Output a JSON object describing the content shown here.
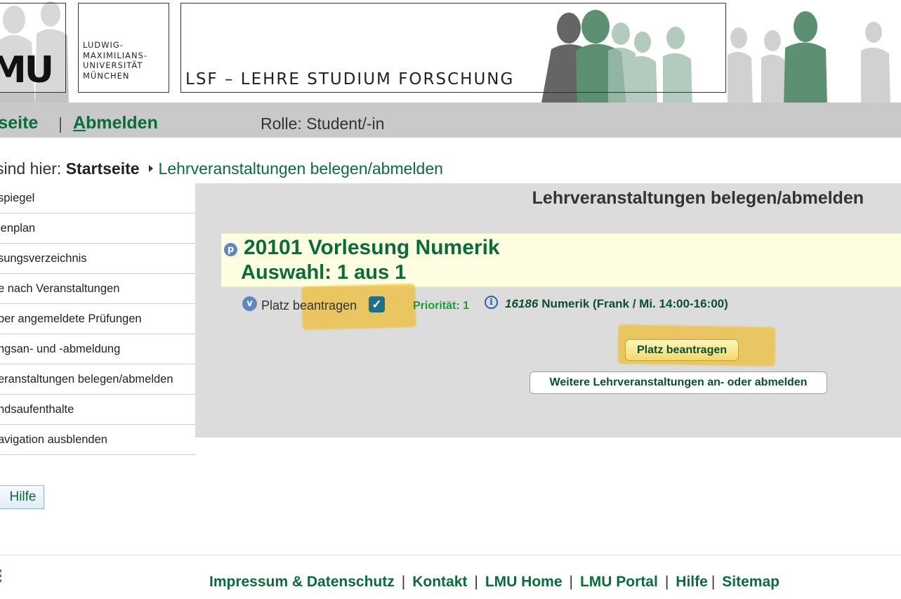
{
  "header": {
    "logo_letters": "MU",
    "university_name": "LUDWIG-\nMAXIMILIANS-\nUNIVERSITÄT\nMÜNCHEN",
    "site_title": "LSF – LEHRE STUDIUM FORSCHUNG"
  },
  "topnav": {
    "home_label": "tseite",
    "separator": "|",
    "logout_first": "A",
    "logout_rest": "bmelden",
    "role": "Rolle: Student/-in"
  },
  "breadcrumb": {
    "prefix": "sind hier:",
    "current": "Startseite",
    "link": "Lehrveranstaltungen belegen/abmelden"
  },
  "sidebar": {
    "items": [
      {
        "label": "spiegel"
      },
      {
        "label": "lenplan"
      },
      {
        "label": "sungsverzeichnis"
      },
      {
        "label": "e nach Veranstaltungen"
      },
      {
        "label": "ber angemeldete Prüfungen"
      },
      {
        "label": "ngsan- und -abmeldung"
      },
      {
        "label": "eranstaltungen belegen/abmelden"
      },
      {
        "label": "ndsaufenthalte"
      },
      {
        "label": "avigation ausblenden"
      }
    ],
    "help_label": "Hilfe"
  },
  "main": {
    "title": "Lehrveranstaltungen belegen/abmelden",
    "course": {
      "icon": "p",
      "title": "20101 Vorlesung Numerik",
      "choice": "Auswahl: 1 aus 1"
    },
    "option": {
      "icon": "v",
      "label": "Platz beantragen",
      "checked": true,
      "check_glyph": "✓",
      "priority": "Priorität: 1",
      "info_glyph": "i",
      "course_number": "16186",
      "course_text": "Numerik (Frank / Mi.  14:00-16:00)"
    },
    "apply_button": "Platz beantragen",
    "more_button": "Weitere Lehrveranstaltungen an- oder abmelden"
  },
  "footer": {
    "links": [
      "Impressum & Datenschutz",
      "Kontakt",
      "LMU Home",
      "LMU Portal",
      "Hilfe",
      "Sitemap"
    ],
    "separator": "|"
  },
  "colors": {
    "brand_green": "#0b6b3a",
    "nav_bar": "#c9c9c9",
    "panel": "#dcdcdc",
    "course_box": "#fdfde2",
    "highlight": "#eebe32",
    "icon_blue": "#5e87c2"
  },
  "icons": {
    "course_marker": "p-circle-icon",
    "option_marker": "v-circle-icon",
    "checkbox": "checkbox-checked-icon",
    "info": "info-icon",
    "breadcrumb_arrow": "triangle-right-icon"
  }
}
